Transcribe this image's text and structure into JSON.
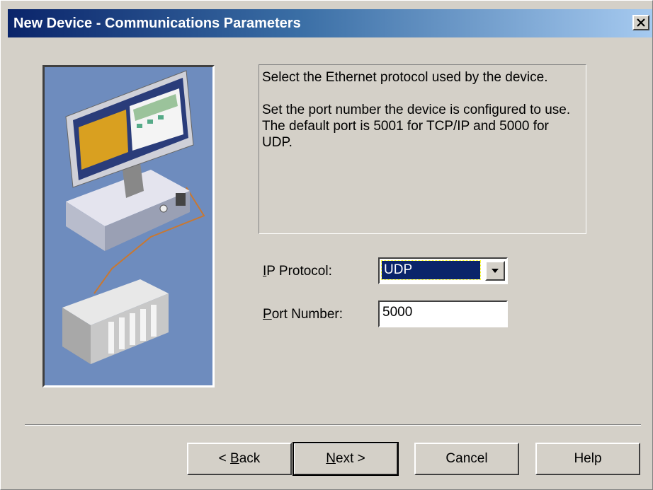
{
  "window": {
    "title": "New Device - Communications Parameters"
  },
  "info": {
    "line1": "Select the Ethernet protocol used by the device.",
    "line2": "Set the port number the device is configured to use. The default port is 5001 for TCP/IP and 5000 for UDP."
  },
  "form": {
    "ip_protocol_label_underline": "I",
    "ip_protocol_label_rest": "P Protocol:",
    "ip_protocol_value": "UDP",
    "port_label_underline": "P",
    "port_label_rest": "ort Number:",
    "port_value": "5000"
  },
  "buttons": {
    "back_prefix": "< ",
    "back_underline": "B",
    "back_rest": "ack",
    "next_underline": "N",
    "next_rest": "ext >",
    "cancel": "Cancel",
    "help": "Help"
  },
  "icons": {
    "close": "close-icon",
    "dropdown": "chevron-down-icon",
    "illustration": "computer-network-illustration"
  },
  "colors": {
    "title_gradient_start": "#0a246a",
    "title_gradient_end": "#a6caf0",
    "dialog_bg": "#d4d0c8",
    "selection": "#0a246a",
    "illustration_bg": "#6e8cbe"
  }
}
